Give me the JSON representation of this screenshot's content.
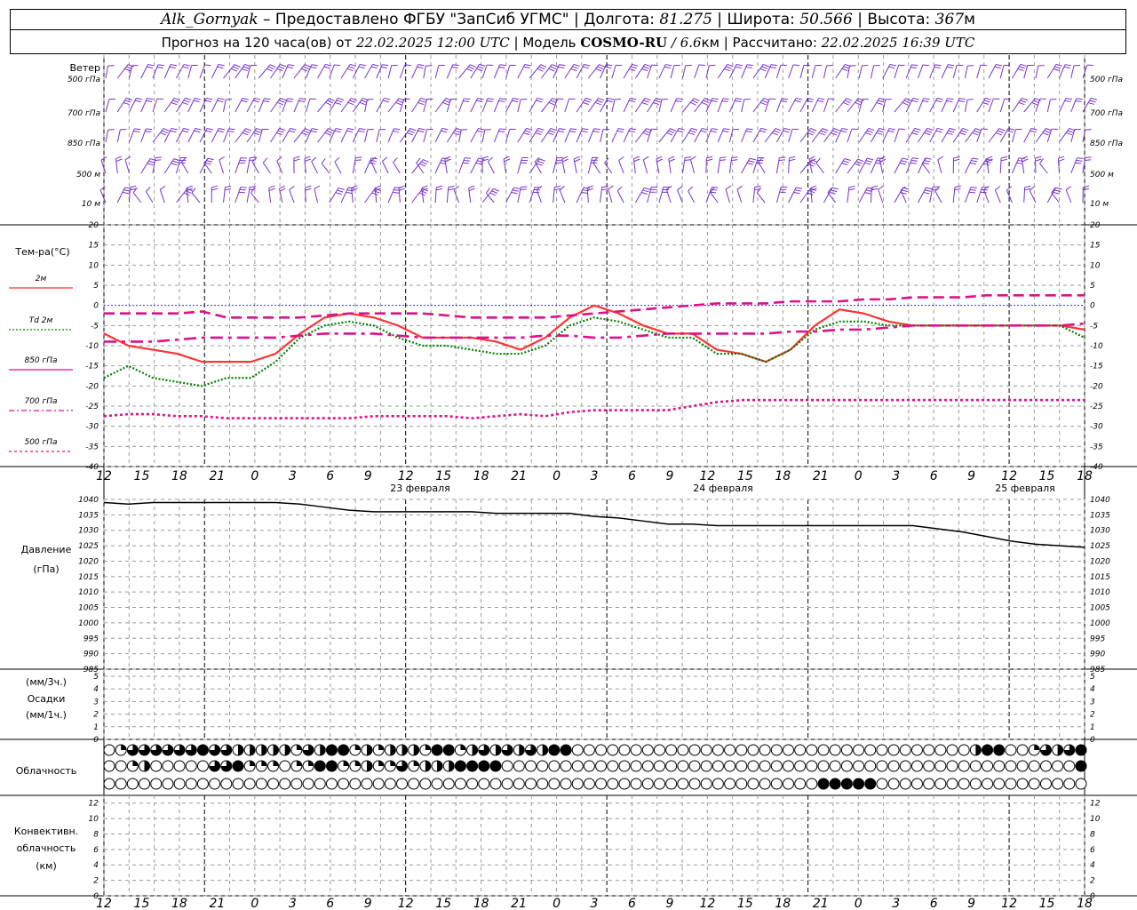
{
  "header": {
    "station": "Alk_Gornyak",
    "provider": " – Предоставлено ФГБУ \"ЗапСиб УГМС\" | Долгота: ",
    "lon": "81.275",
    "lat_label": " | Широта: ",
    "lat": "50.566",
    "alt_label": " | Высота: ",
    "alt": "367",
    "alt_unit": "м",
    "fc_label": "Прогноз на 120 часа(ов) от ",
    "fc_time": "22.02.2025 12:00 UTC",
    "model_label": "  | Модель ",
    "model": "COSMO-RU",
    "res": " / 6.6",
    "res_unit": "км",
    "calc_label": " | Рассчитано: ",
    "calc_time": "22.02.2025 16:39 UTC"
  },
  "wind_panel": {
    "title": "Ветер",
    "levels": [
      "500 гПа",
      "700 гПа",
      "850 гПа",
      "500 м",
      "10  м"
    ],
    "right_levels": [
      "500 гПа",
      "700 гПа",
      "850 гПа",
      "500 м",
      "10  м"
    ]
  },
  "temp_panel": {
    "title": "Тем-ра(°C)",
    "legend": [
      {
        "label": "2м",
        "color": "#ff3333",
        "style": "solid"
      },
      {
        "label": "Td  2м",
        "color": "#008000",
        "style": "dotted"
      },
      {
        "label": "850 гПа",
        "color": "#dd1188",
        "style": "dash"
      },
      {
        "label": "700 гПа",
        "color": "#dd1188",
        "style": "dashdot"
      },
      {
        "label": "500 гПа",
        "color": "#dd1188",
        "style": "dotted"
      }
    ]
  },
  "pressure_panel": {
    "title": "Давление",
    "unit": "(гПа)"
  },
  "precip_panel": {
    "unit_top": "(мм/3ч.)",
    "title": "Осадки",
    "unit_bottom": "(мм/1ч.)"
  },
  "cloud_panel": {
    "title": "Облачность"
  },
  "conv_panel": {
    "title_1": "Конвективн.",
    "title_2": "облачность",
    "unit": "(км)"
  },
  "x_axis": {
    "labels": [
      "12",
      "15",
      "18",
      "21",
      "0",
      "3",
      "6",
      "9",
      "12",
      "15",
      "18",
      "21",
      "0",
      "3",
      "6",
      "9",
      "12",
      "15",
      "18",
      "21",
      "0",
      "3",
      "6",
      "9",
      "12",
      "15",
      "18"
    ],
    "dates": [
      "23 февраля",
      "24 февраля",
      "25 февраля"
    ]
  },
  "chart_data": [
    {
      "type": "line",
      "title": "Тем-ра(°C)",
      "x_unit": "hours from 22.02.2025 12:00 UTC",
      "ylim": [
        -40,
        20
      ],
      "yticks": [
        20,
        15,
        10,
        5,
        0,
        -5,
        -10,
        -15,
        -20,
        -25,
        -30,
        -35,
        -40
      ],
      "series": [
        {
          "name": "2м",
          "x": [
            0,
            3,
            6,
            9,
            12,
            15,
            18,
            21,
            24,
            27,
            30,
            33,
            36,
            39,
            42,
            45,
            48,
            51,
            54,
            57,
            60,
            63,
            66,
            69,
            72,
            75,
            78,
            81,
            84,
            87,
            90,
            93,
            96,
            99,
            102,
            105,
            108,
            111,
            114,
            117,
            120
          ],
          "values": [
            -7,
            -10,
            -11,
            -12,
            -14,
            -14,
            -14,
            -12,
            -7,
            -3,
            -2,
            -3,
            -5,
            -8,
            -8,
            -8,
            -9,
            -11,
            -8,
            -3,
            0,
            -2,
            -5,
            -7,
            -7,
            -11,
            -12,
            -14,
            -11,
            -5,
            -1,
            -2,
            -4,
            -5,
            -5,
            -5,
            -5,
            -5,
            -5,
            -5,
            -6
          ]
        },
        {
          "name": "Td  2м",
          "x": [
            0,
            3,
            6,
            9,
            12,
            15,
            18,
            21,
            24,
            27,
            30,
            33,
            36,
            39,
            42,
            45,
            48,
            51,
            54,
            57,
            60,
            63,
            66,
            69,
            72,
            75,
            78,
            81,
            84,
            87,
            90,
            93,
            96,
            99,
            102,
            105,
            108,
            111,
            114,
            117,
            120
          ],
          "values": [
            -18,
            -15,
            -18,
            -19,
            -20,
            -18,
            -18,
            -14,
            -8,
            -5,
            -4,
            -5,
            -8,
            -10,
            -10,
            -11,
            -12,
            -12,
            -10,
            -5,
            -3,
            -4,
            -6,
            -8,
            -8,
            -12,
            -12,
            -14,
            -11,
            -6,
            -4,
            -4,
            -5,
            -5,
            -5,
            -5,
            -5,
            -5,
            -5,
            -5,
            -8
          ]
        },
        {
          "name": "850 гПа",
          "x": [
            0,
            3,
            6,
            9,
            12,
            15,
            18,
            21,
            24,
            27,
            30,
            33,
            36,
            39,
            42,
            45,
            48,
            51,
            54,
            57,
            60,
            63,
            66,
            69,
            72,
            75,
            78,
            81,
            84,
            87,
            90,
            93,
            96,
            99,
            102,
            105,
            108,
            111,
            114,
            117,
            120
          ],
          "values": [
            -2,
            -2,
            -2,
            -2,
            -1.5,
            -3,
            -3,
            -3,
            -3,
            -2.5,
            -2,
            -2,
            -2,
            -2,
            -2.5,
            -3,
            -3,
            -3,
            -3,
            -2.5,
            -2,
            -1.5,
            -1,
            -0.5,
            0,
            0.5,
            0.5,
            0.5,
            1,
            1,
            1,
            1.5,
            1.5,
            2,
            2,
            2,
            2.5,
            2.5,
            2.5,
            2.5,
            2.5
          ]
        },
        {
          "name": "700 гПа",
          "x": [
            0,
            3,
            6,
            9,
            12,
            15,
            18,
            21,
            24,
            27,
            30,
            33,
            36,
            39,
            42,
            45,
            48,
            51,
            54,
            57,
            60,
            63,
            66,
            69,
            72,
            75,
            78,
            81,
            84,
            87,
            90,
            93,
            96,
            99,
            102,
            105,
            108,
            111,
            114,
            117,
            120
          ],
          "values": [
            -9,
            -9,
            -9,
            -8.5,
            -8,
            -8,
            -8,
            -8,
            -7.5,
            -7,
            -7,
            -7,
            -7.5,
            -8,
            -8,
            -8,
            -8,
            -8,
            -7.5,
            -7.5,
            -8,
            -8,
            -7.5,
            -7,
            -7,
            -7,
            -7,
            -7,
            -6.5,
            -6.5,
            -6,
            -6,
            -5.5,
            -5,
            -5,
            -5,
            -5,
            -5,
            -5,
            -5,
            -4.5
          ]
        },
        {
          "name": "500 гПа",
          "x": [
            0,
            3,
            6,
            9,
            12,
            15,
            18,
            21,
            24,
            27,
            30,
            33,
            36,
            39,
            42,
            45,
            48,
            51,
            54,
            57,
            60,
            63,
            66,
            69,
            72,
            75,
            78,
            81,
            84,
            87,
            90,
            93,
            96,
            99,
            102,
            105,
            108,
            111,
            114,
            117,
            120
          ],
          "values": [
            -27.5,
            -27,
            -27,
            -27.5,
            -27.5,
            -28,
            -28,
            -28,
            -28,
            -28,
            -28,
            -27.5,
            -27.5,
            -27.5,
            -27.5,
            -28,
            -27.5,
            -27,
            -27.5,
            -26.5,
            -26,
            -26,
            -26,
            -26,
            -25,
            -24,
            -23.5,
            -23.5,
            -23.5,
            -23.5,
            -23.5,
            -23.5,
            -23.5,
            -23.5,
            -23.5,
            -23.5,
            -23.5,
            -23.5,
            -23.5,
            -23.5,
            -23.5
          ]
        }
      ]
    },
    {
      "type": "line",
      "title": "Давление",
      "ylabel": "(гПа)",
      "ylim": [
        985,
        1040
      ],
      "yticks": [
        1040,
        1035,
        1030,
        1025,
        1020,
        1015,
        1010,
        1005,
        1000,
        995,
        990,
        985
      ],
      "series": [
        {
          "x": [
            0,
            3,
            6,
            9,
            12,
            15,
            18,
            21,
            24,
            27,
            30,
            33,
            36,
            39,
            42,
            45,
            48,
            51,
            54,
            57,
            60,
            63,
            66,
            69,
            72,
            75,
            78,
            81,
            84,
            87,
            90,
            93,
            96,
            99,
            102,
            105,
            108,
            111,
            114,
            117,
            120
          ],
          "values": [
            1039,
            1038.5,
            1039,
            1039,
            1039,
            1039,
            1039,
            1039,
            1038.5,
            1037.5,
            1036.5,
            1036,
            1036,
            1036,
            1036,
            1036,
            1035.5,
            1035.5,
            1035.5,
            1035.5,
            1034.5,
            1034,
            1033,
            1032,
            1032,
            1031.5,
            1031.5,
            1031.5,
            1031.5,
            1031.5,
            1031.5,
            1031.5,
            1031.5,
            1031.5,
            1030.5,
            1029.5,
            1028,
            1026.5,
            1025.5,
            1025,
            1024.5
          ]
        }
      ]
    },
    {
      "type": "bar",
      "title": "Осадки",
      "ylim": [
        0,
        5
      ],
      "yticks": [
        5,
        4,
        3,
        2,
        1,
        0
      ],
      "series": []
    },
    {
      "type": "table",
      "title": "Облачность",
      "rows": [
        "OQTTTTTTFTTHHHHHQTHFFQHQHHHQFFQHTHTHTHFFOOOOOOOOOOOOOOOOOOOOOOOOOOOOOOOOOOHFFOOQTHTF",
        "OOQHOOOOOTTFQQQOQQFFQQHQQTQHHHFFFFOOOOOOOOOOOOOOOOOOOOOOOOOOOOOOOOOOOOOOOOOOOOOOOOOF",
        "OOOOOOOOOOOOOOOOOOOOOOOOOOOOOOOOOOOOOOOOOOOOOOOOOOOOOOOOOOOOOFFFFFOOOOOOOOOOOOOOOOOOO"
      ]
    },
    {
      "type": "bar",
      "title": "Конвективн. облачность",
      "ylabel": "(км)",
      "ylim": [
        0,
        13
      ],
      "yticks": [
        12,
        10,
        8,
        6,
        4,
        2,
        0
      ],
      "series": []
    }
  ]
}
